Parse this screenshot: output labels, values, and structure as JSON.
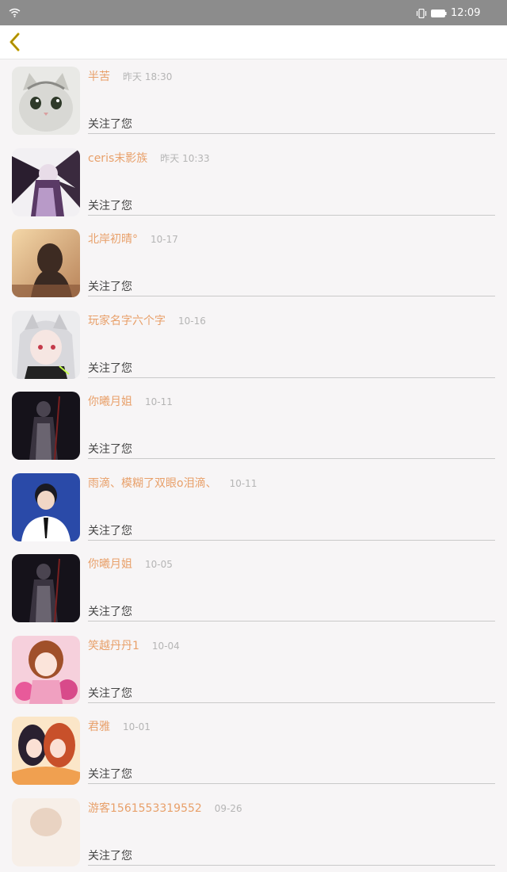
{
  "status_bar": {
    "time": "12:09"
  },
  "nav": {
    "back_icon": "chevron-left-icon",
    "accent": "#c8a400"
  },
  "colors": {
    "name": "#e8a06a",
    "time": "#b5b5b5",
    "action": "#444444",
    "divider": "#c9c9c9"
  },
  "notifications": [
    {
      "name": "半苦",
      "time": "昨天 18:30",
      "action": "关注了您",
      "avatar": "cat"
    },
    {
      "name": "ceris末影族",
      "time": "昨天 10:33",
      "action": "关注了您",
      "avatar": "dark-wing"
    },
    {
      "name": "北岸初晴°",
      "time": "10-17",
      "action": "关注了您",
      "avatar": "sunset-girl"
    },
    {
      "name": "玩家名字六个字",
      "time": "10-16",
      "action": "关注了您",
      "avatar": "white-hair"
    },
    {
      "name": "你曦月姐",
      "time": "10-11",
      "action": "关注了您",
      "avatar": "dark-figure"
    },
    {
      "name": "雨滴、模糊了双眼o泪滴、",
      "time": "10-11",
      "action": "关注了您",
      "avatar": "boy"
    },
    {
      "name": "你曦月姐",
      "time": "10-05",
      "action": "关注了您",
      "avatar": "dark-figure"
    },
    {
      "name": "笑越丹丹1",
      "time": "10-04",
      "action": "关注了您",
      "avatar": "pink-girl"
    },
    {
      "name": "君雅",
      "time": "10-01",
      "action": "关注了您",
      "avatar": "two-girls"
    },
    {
      "name": "游客1561553319552",
      "time": "09-26",
      "action": "关注了您",
      "avatar": "light"
    }
  ]
}
